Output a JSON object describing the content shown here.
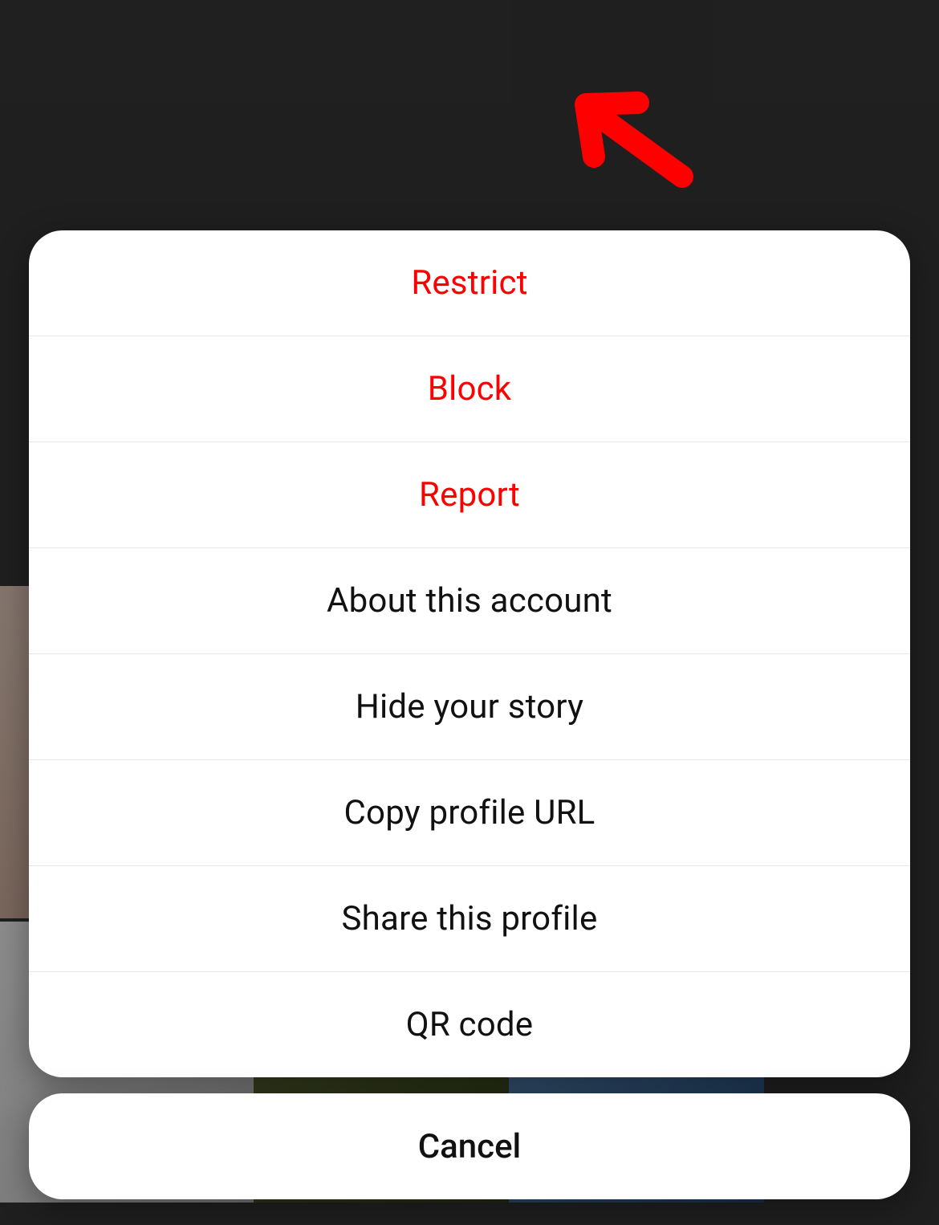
{
  "actionSheet": {
    "items": [
      {
        "label": "Restrict",
        "destructive": true
      },
      {
        "label": "Block",
        "destructive": true
      },
      {
        "label": "Report",
        "destructive": true
      },
      {
        "label": "About this account",
        "destructive": false
      },
      {
        "label": "Hide your story",
        "destructive": false
      },
      {
        "label": "Copy profile URL",
        "destructive": false
      },
      {
        "label": "Share this profile",
        "destructive": false
      },
      {
        "label": "QR code",
        "destructive": false
      }
    ],
    "cancel_label": "Cancel"
  },
  "annotation": {
    "target": "restrict",
    "color": "#fe0000"
  }
}
